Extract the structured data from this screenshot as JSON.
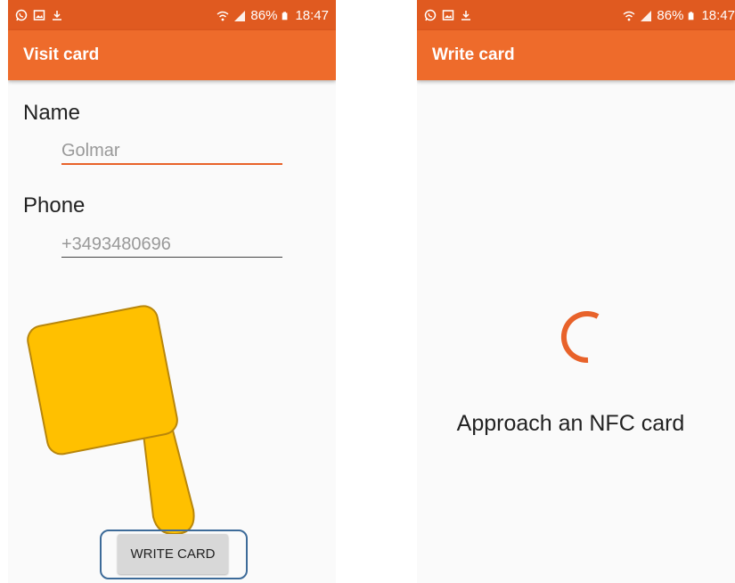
{
  "status_bar": {
    "battery": "86%",
    "time": "18:47",
    "icons": [
      "whatsapp-icon",
      "gallery-icon",
      "download-icon",
      "wifi-icon",
      "signal-icon",
      "battery-icon"
    ]
  },
  "visit_card_screen": {
    "title": "Visit card",
    "name_label": "Name",
    "name_value": "Golmar",
    "phone_label": "Phone",
    "phone_value": "+3493480696",
    "write_button_label": "WRITE CARD"
  },
  "write_card_screen": {
    "title": "Write card",
    "message": "Approach an NFC card"
  },
  "colors": {
    "status_bar": "#e05a20",
    "app_bar": "#ee6b2b",
    "accent": "#e8622a",
    "highlight_frame": "#3d6b99",
    "pointer_hand": "#ffc000"
  }
}
